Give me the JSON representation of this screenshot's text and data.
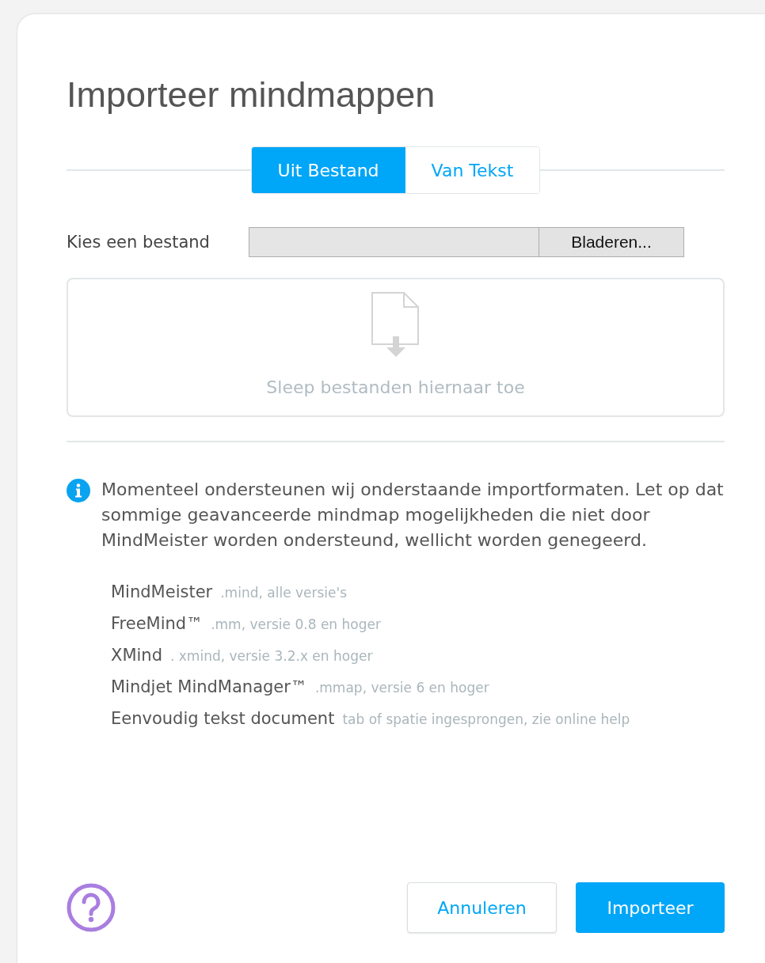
{
  "dialog": {
    "title": "Importeer mindmappen"
  },
  "tabs": [
    {
      "label": "Uit Bestand",
      "selected": true
    },
    {
      "label": "Van Tekst",
      "selected": false
    }
  ],
  "file_picker": {
    "label": "Kies een bestand",
    "button": "Bladeren..."
  },
  "dropzone": {
    "text": "Sleep bestanden hiernaar toe"
  },
  "info": {
    "text": "Momenteel ondersteunen wij onderstaande importformaten. Let op dat sommige geavanceerde mindmap mogelijkheden die niet door MindMeister worden ondersteund, wellicht worden genegeerd."
  },
  "formats": [
    {
      "name": "MindMeister",
      "detail": ".mind, alle versie's"
    },
    {
      "name": "FreeMind™",
      "detail": ".mm, versie 0.8 en hoger"
    },
    {
      "name": "XMind",
      "detail": ". xmind, versie 3.2.x en hoger"
    },
    {
      "name": "Mindjet MindManager™",
      "detail": ".mmap, versie 6 en hoger"
    },
    {
      "name": "Eenvoudig tekst document",
      "detail": "tab of spatie ingesprongen, zie online help"
    }
  ],
  "buttons": [
    {
      "label": "Annuleren",
      "kind": "secondary"
    },
    {
      "label": "Importeer",
      "kind": "primary"
    }
  ]
}
